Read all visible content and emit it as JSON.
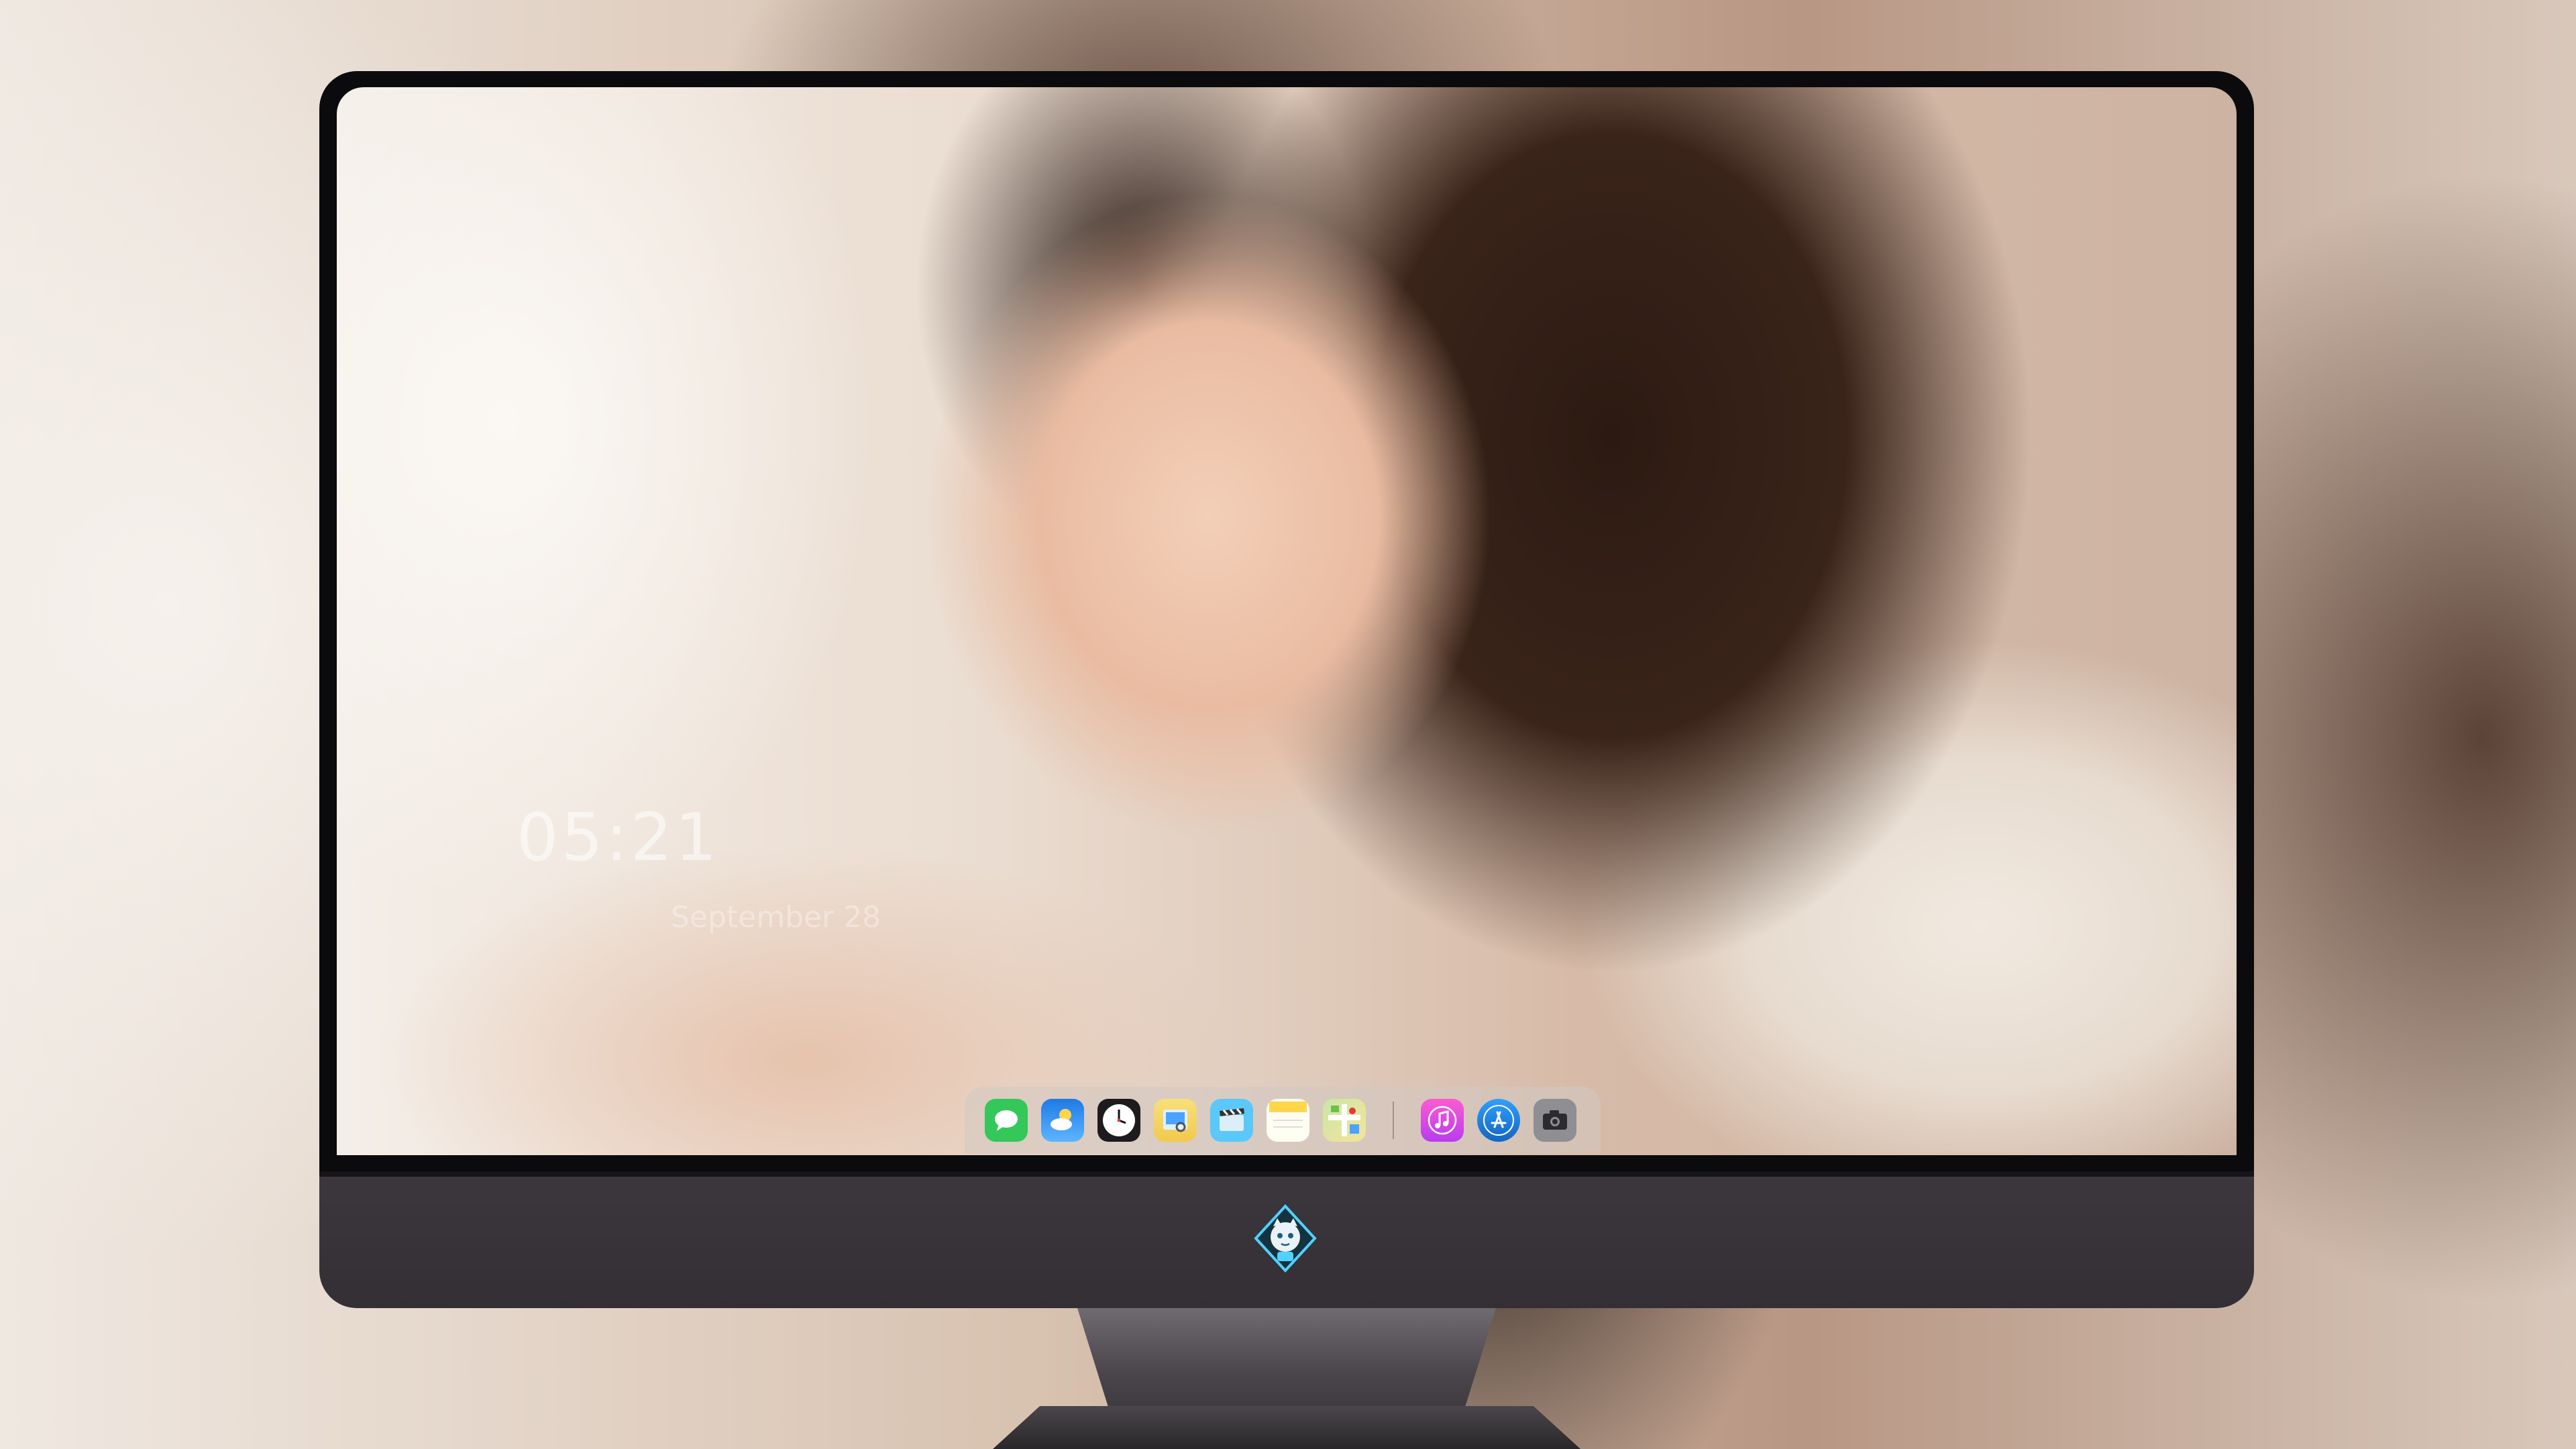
{
  "lockscreen": {
    "time": "05:21",
    "date": "September 28"
  },
  "dock": {
    "apps": [
      {
        "name": "messages-icon",
        "color": "#34c759"
      },
      {
        "name": "weather-icon",
        "color": "#3a8ef0"
      },
      {
        "name": "clock-icon",
        "color": "#1c1c1e"
      },
      {
        "name": "preview-icon",
        "color": "#f2c94c"
      },
      {
        "name": "clips-icon",
        "color": "#5ac8fa"
      },
      {
        "name": "notes-icon",
        "color": "#ffd54a"
      },
      {
        "name": "maps-icon",
        "color": "#6cc04a"
      },
      {
        "name": "music-icon",
        "color": "#e040fb"
      },
      {
        "name": "app-store-icon",
        "color": "#1e88e5"
      },
      {
        "name": "camera-icon",
        "color": "#8e8e93"
      }
    ]
  },
  "colors": {
    "bezel": "#0b0b0d",
    "chin": "#38343a",
    "stand": "#5a565b"
  }
}
